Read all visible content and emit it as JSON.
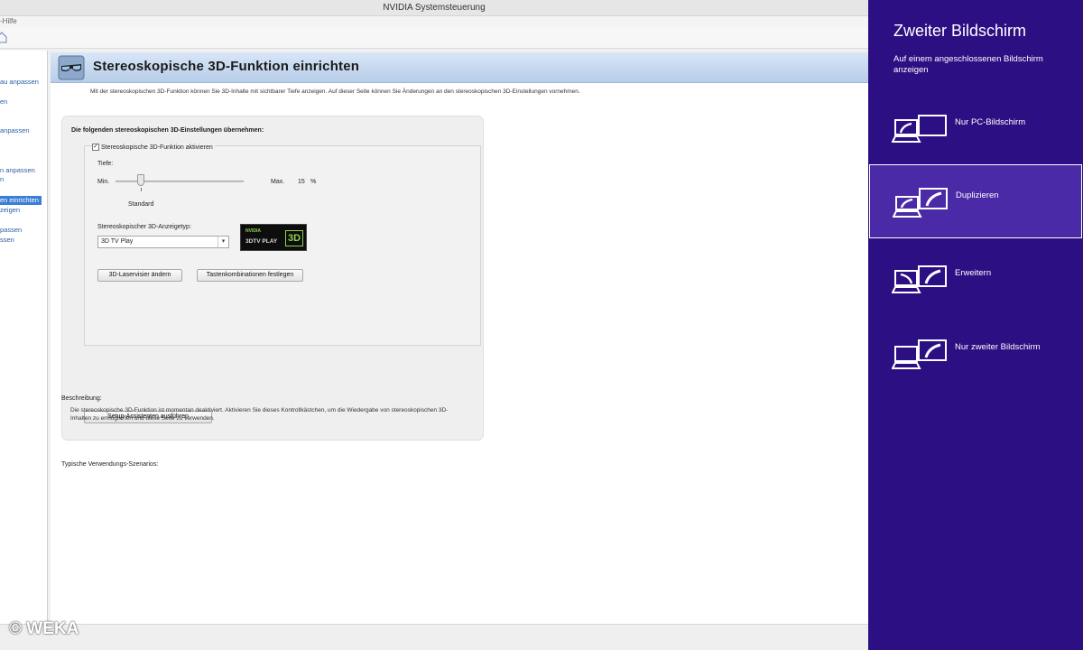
{
  "window": {
    "title": "NVIDIA Systemsteuerung",
    "menu_fragment": "-Hilfe"
  },
  "sidebar": {
    "items": [
      {
        "label": "au anpassen",
        "selected": false
      },
      {
        "label": "en",
        "selected": false
      },
      {
        "label": "anpassen",
        "selected": false
      },
      {
        "label": "n anpassen",
        "selected": false
      },
      {
        "label": "n",
        "selected": false
      },
      {
        "label": "en einrichten",
        "selected": true
      },
      {
        "label": "zeigen",
        "selected": true
      },
      {
        "label": "passen",
        "selected": false
      },
      {
        "label": "ssen",
        "selected": false
      }
    ]
  },
  "page": {
    "title": "Stereoskopische 3D-Funktion einrichten",
    "intro": "Mit der stereoskopischen 3D-Funktion können Sie 3D-Inhalte mit sichtbarer Tiefe anzeigen. Auf dieser Seite können Sie Änderungen an den stereoskopischen 3D-Einstellungen vornehmen."
  },
  "settings": {
    "heading": "Die folgenden stereoskopischen 3D-Einstellungen übernehmen:",
    "enable_checkbox_label": "Stereoskopische 3D-Funktion aktivieren",
    "enable_checked": true,
    "depth_label": "Tiefe:",
    "slider_min": "Min.",
    "slider_max": "Max.",
    "depth_value": "15",
    "depth_unit": "%",
    "depth_fraction": 0.15,
    "slider_default_label": "Standard",
    "display_type_label": "Stereoskopischer 3D-Anzeigetyp:",
    "display_type_value": "3D TV Play",
    "badge": {
      "brand": "NVIDIA",
      "product": "3DTV PLAY",
      "mark": "3D"
    },
    "laser_button": "3D-Laservisier ändern",
    "hotkeys_button": "Tastenkombinationen festlegen",
    "wizard_button": "Setup-Assistenten ausführen"
  },
  "description": {
    "heading": "Beschreibung:",
    "text": "Die stereoskopische 3D-Funktion ist momentan deaktiviert. Aktivieren Sie dieses Kontrollkästchen, um die Wiedergabe von stereoskopischen 3D-Inhalten zu ermöglichen und diese Seite zu verwenden.",
    "usage_heading": "Typische Verwendungs-Szenarios:"
  },
  "watermark": "© WEKA",
  "charm": {
    "title": "Zweiter Bildschirm",
    "subtitle": "Auf einem angeschlossenen Bildschirm anzeigen",
    "options": [
      {
        "label": "Nur PC-Bildschirm",
        "icon": "pc-screen-only-icon",
        "selected": false
      },
      {
        "label": "Duplizieren",
        "icon": "duplicate-icon",
        "selected": true
      },
      {
        "label": "Erweitern",
        "icon": "extend-icon",
        "selected": false
      },
      {
        "label": "Nur zweiter Bildschirm",
        "icon": "second-screen-only-icon",
        "selected": false
      }
    ],
    "colors": {
      "background": "#2c0f82",
      "selected": "#4a2aa7"
    }
  }
}
